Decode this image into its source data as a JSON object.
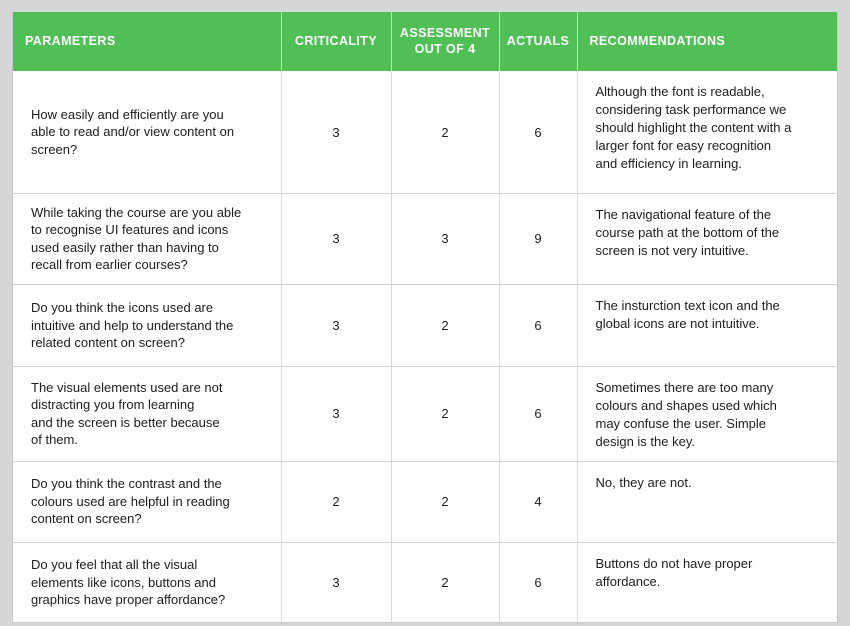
{
  "table": {
    "columns": [
      {
        "key": "parameters",
        "label": "PARAMETERS",
        "align": "left"
      },
      {
        "key": "criticality",
        "label": "CRITICALITY",
        "align": "center"
      },
      {
        "key": "assessment_l1",
        "label": "ASSESSMENT",
        "align": "center"
      },
      {
        "key": "assessment_l2",
        "label": "OUT OF 4",
        "align": "center"
      },
      {
        "key": "actuals",
        "label": "ACTUALS",
        "align": "center"
      },
      {
        "key": "recommendations",
        "label": "RECOMMENDATIONS",
        "align": "left"
      }
    ],
    "header_bg": "#4fbf56",
    "header_text_color": "#ffffff",
    "page_bg": "#d6d6d6",
    "rows": [
      {
        "parameter": "How easily and efficiently are you\nable to read and/or view content on\nscreen?",
        "criticality": "3",
        "assessment": "2",
        "actuals": "6",
        "recommendation": "Although the font is readable,\nconsidering task performance we\nshould highlight the content with a\nlarger font for easy recognition\nand efficiency in learning."
      },
      {
        "parameter": "While taking the course are you able\nto recognise UI features and icons\nused easily rather than having to\nrecall from earlier courses?",
        "criticality": "3",
        "assessment": "3",
        "actuals": "9",
        "recommendation": "The navigational feature of the\ncourse path at the bottom of the\nscreen is not very intuitive."
      },
      {
        "parameter": "Do you think the icons used are\nintuitive and help to understand the\nrelated content on screen?",
        "criticality": "3",
        "assessment": "2",
        "actuals": "6",
        "recommendation": "The insturction text icon and the\nglobal icons are not intuitive."
      },
      {
        "parameter": "The visual elements used are not\ndistracting you from learning\nand the screen is better because\nof them.",
        "criticality": "3",
        "assessment": "2",
        "actuals": "6",
        "recommendation": "Sometimes there are too many\ncolours and shapes used which\nmay confuse the user. Simple\ndesign is the key."
      },
      {
        "parameter": "Do you think the contrast and the\ncolours used are helpful in reading\ncontent on screen?",
        "criticality": "2",
        "assessment": "2",
        "actuals": "4",
        "recommendation": "No, they are not."
      },
      {
        "parameter": "Do you feel that all the visual\nelements like icons, buttons and\ngraphics have proper affordance?",
        "criticality": "3",
        "assessment": "2",
        "actuals": "6",
        "recommendation": "Buttons do not have proper\naffordance."
      }
    ]
  }
}
